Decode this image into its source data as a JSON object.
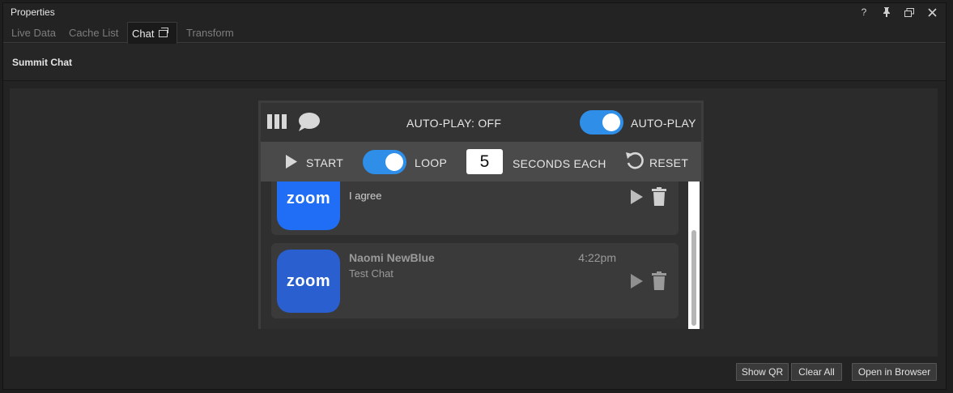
{
  "window": {
    "title": "Properties"
  },
  "tabs": [
    {
      "label": "Live Data"
    },
    {
      "label": "Cache List"
    },
    {
      "label": "Chat"
    },
    {
      "label": "Transform"
    }
  ],
  "section": {
    "title": "Summit Chat"
  },
  "controls": {
    "autoplay_status": "AUTO-PLAY: OFF",
    "autoplay_label": "AUTO-PLAY",
    "start_label": "START",
    "loop_label": "LOOP",
    "seconds_value": "5",
    "seconds_label": "SECONDS EACH",
    "reset_label": "RESET"
  },
  "messages": [
    {
      "name": "",
      "text": "I agree",
      "time": "",
      "logo": "zoom"
    },
    {
      "name": "Naomi NewBlue",
      "text": "Test Chat",
      "time": "4:22pm",
      "logo": "zoom"
    }
  ],
  "buttons": {
    "show_qr": "Show QR",
    "clear_all": "Clear All",
    "open_browser": "Open in Browser"
  },
  "colors": {
    "accent": "#2f8fe8",
    "zoom": "#1f6ef5"
  }
}
